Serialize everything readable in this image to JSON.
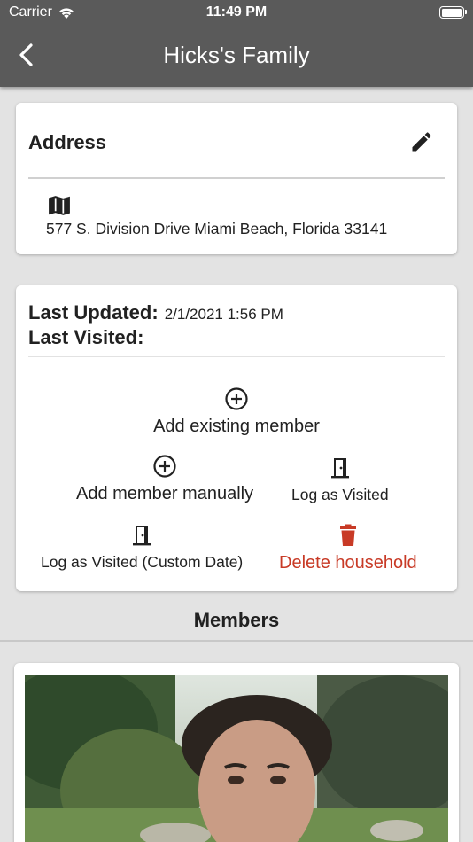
{
  "status_bar": {
    "carrier": "Carrier",
    "time": "11:49 PM",
    "battery_level": 1.0
  },
  "app_bar": {
    "title": "Hicks's Family",
    "back_icon": "chevron-left-icon"
  },
  "address_card": {
    "title": "Address",
    "edit_icon": "pencil-icon",
    "map_icon": "map-icon",
    "address": "577 S. Division Drive Miami Beach, Florida 33141"
  },
  "info_card": {
    "last_updated_label": "Last Updated:",
    "last_updated_value": "2/1/2021 1:56 PM",
    "last_visited_label": "Last Visited:",
    "last_visited_value": ""
  },
  "actions": {
    "add_existing": "Add existing member",
    "add_manual": "Add member manually",
    "log_visited": "Log as Visited",
    "log_visited_custom": "Log as Visited (Custom Date)",
    "delete_household": "Delete household"
  },
  "members": {
    "title": "Members"
  },
  "colors": {
    "app_bar": "#5a5a5a",
    "danger": "#c83a26",
    "background": "#e3e3e3"
  }
}
